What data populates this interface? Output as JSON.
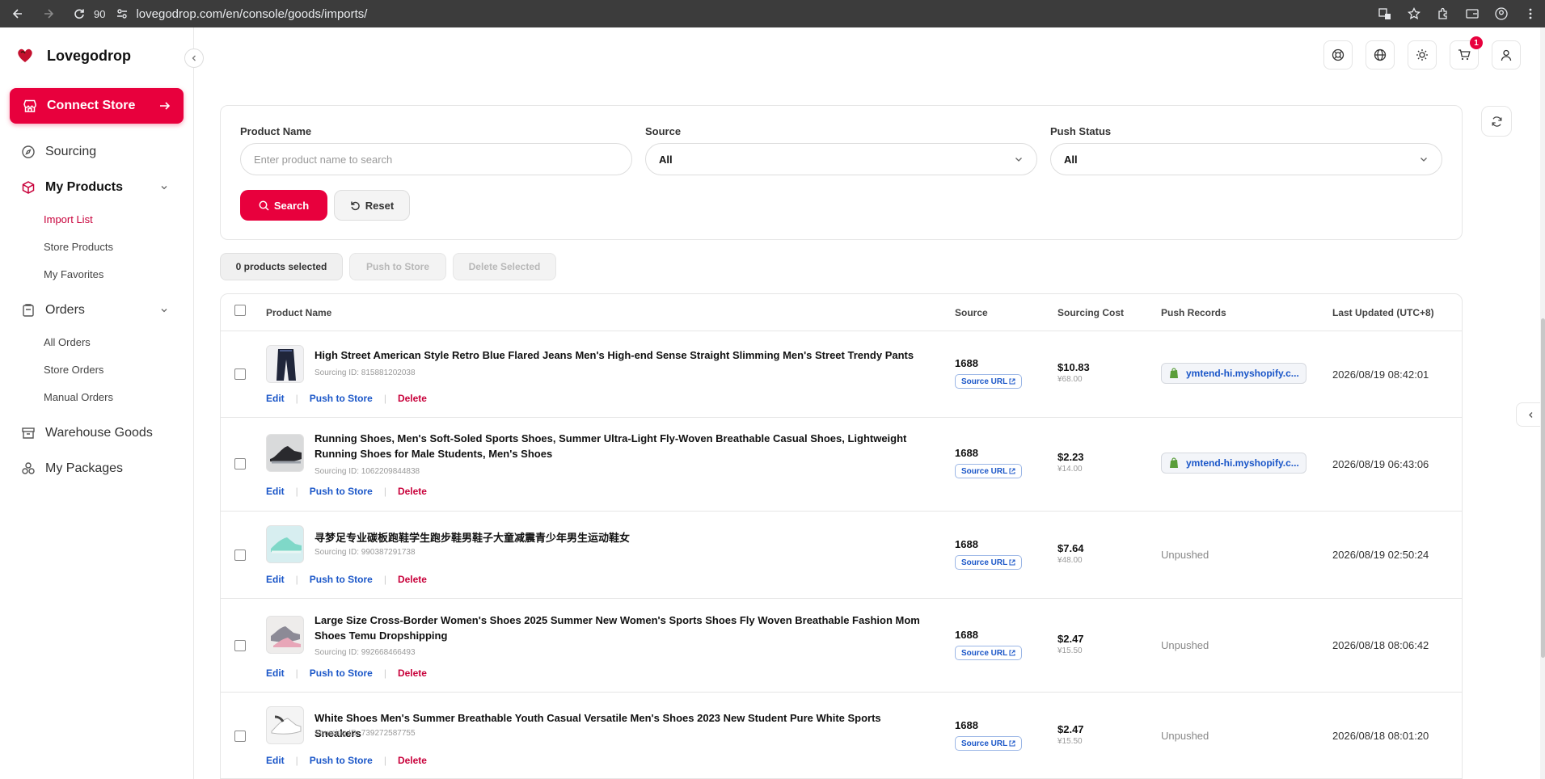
{
  "browser": {
    "zoom": "90",
    "url": "lovegodrop.com/en/console/goods/imports/"
  },
  "brand": {
    "name": "Lovegodrop"
  },
  "connect_store": {
    "label": "Connect Store"
  },
  "sidebar": {
    "sourcing": "Sourcing",
    "my_products": {
      "label": "My Products",
      "items": [
        "Import List",
        "Store Products",
        "My Favorites"
      ]
    },
    "orders": {
      "label": "Orders",
      "items": [
        "All Orders",
        "Store Orders",
        "Manual Orders"
      ]
    },
    "warehouse_goods": "Warehouse Goods",
    "my_packages": "My Packages"
  },
  "header": {
    "cart_badge": "1"
  },
  "filter": {
    "product_name_label": "Product Name",
    "product_name_placeholder": "Enter product name to search",
    "source_label": "Source",
    "source_value": "All",
    "push_status_label": "Push Status",
    "push_status_value": "All",
    "search_label": "Search",
    "reset_label": "Reset"
  },
  "bulk": {
    "selected": "0 products selected",
    "push": "Push to Store",
    "delete": "Delete Selected"
  },
  "table": {
    "columns": {
      "product_name": "Product Name",
      "source": "Source",
      "sourcing_cost": "Sourcing Cost",
      "push_records": "Push Records",
      "last_updated": "Last Updated (UTC+8)"
    },
    "actions": {
      "edit": "Edit",
      "push": "Push to Store",
      "delete": "Delete"
    },
    "source_url_label": "Source URL",
    "rows": [
      {
        "name": "High Street American Style Retro Blue Flared Jeans Men's High-end Sense Straight Slimming Men's Street Trendy Pants",
        "sourcing_id": "Sourcing ID: 815881202038",
        "source": "1688",
        "cost_usd": "$10.83",
        "cost_cny": "¥68.00",
        "push": "ymtend-hi.myshopify.c...",
        "updated": "2026/08/19 08:42:01"
      },
      {
        "name": "Running Shoes, Men's Soft-Soled Sports Shoes, Summer Ultra-Light Fly-Woven Breathable Casual Shoes, Lightweight Running Shoes for Male Students, Men's Shoes",
        "sourcing_id": "Sourcing ID: 1062209844838",
        "source": "1688",
        "cost_usd": "$2.23",
        "cost_cny": "¥14.00",
        "push": "ymtend-hi.myshopify.c...",
        "updated": "2026/08/19 06:43:06"
      },
      {
        "name": "寻梦足专业碳板跑鞋学生跑步鞋男鞋子大童减震青少年男生运动鞋女",
        "sourcing_id": "Sourcing ID: 990387291738",
        "source": "1688",
        "cost_usd": "$7.64",
        "cost_cny": "¥48.00",
        "push": "Unpushed",
        "updated": "2026/08/19 02:50:24"
      },
      {
        "name": "Large Size Cross-Border Women's Shoes 2025 Summer New Women's Sports Shoes Fly Woven Breathable Fashion Mom Shoes Temu Dropshipping",
        "sourcing_id": "Sourcing ID: 992668466493",
        "source": "1688",
        "cost_usd": "$2.47",
        "cost_cny": "¥15.50",
        "push": "Unpushed",
        "updated": "2026/08/18 08:06:42"
      },
      {
        "name": "White Shoes Men's Summer Breathable Youth Casual Versatile Men's Shoes 2023 New Student Pure White Sports Sneakers",
        "sourcing_id": "Sourcing ID: 739272587755",
        "source": "1688",
        "cost_usd": "$2.47",
        "cost_cny": "¥15.50",
        "push": "Unpushed",
        "updated": "2026/08/18 08:01:20"
      }
    ]
  }
}
